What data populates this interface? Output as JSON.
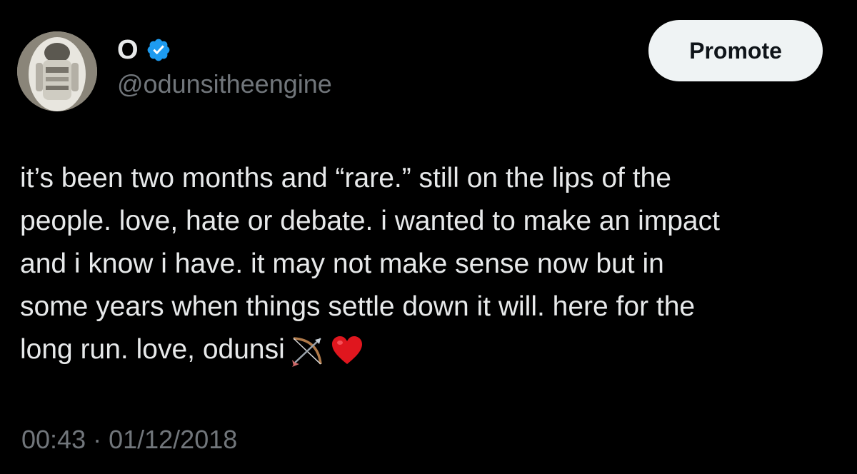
{
  "author": {
    "display_name": "O",
    "handle": "@odunsitheengine",
    "verified_icon": "verified-badge-icon",
    "verified_color": "#1d9bf0"
  },
  "actions": {
    "promote_label": "Promote"
  },
  "tweet": {
    "lines": [
      "it’s been two months and “rare.” still on the lips of the",
      "people. love, hate or debate. i wanted to make an impact",
      "and i know i have. it may not make sense now but in",
      "some years when things settle down it will. here for the",
      "long run. love, odunsi"
    ],
    "emojis": [
      "bow-and-arrow-icon",
      "red-heart-icon"
    ]
  },
  "meta": {
    "timestamp": "00:43 · 01/12/2018"
  },
  "colors": {
    "background": "#000000",
    "text": "#e7e9ea",
    "secondary_text": "#71767b",
    "button_bg": "#eff3f4"
  }
}
